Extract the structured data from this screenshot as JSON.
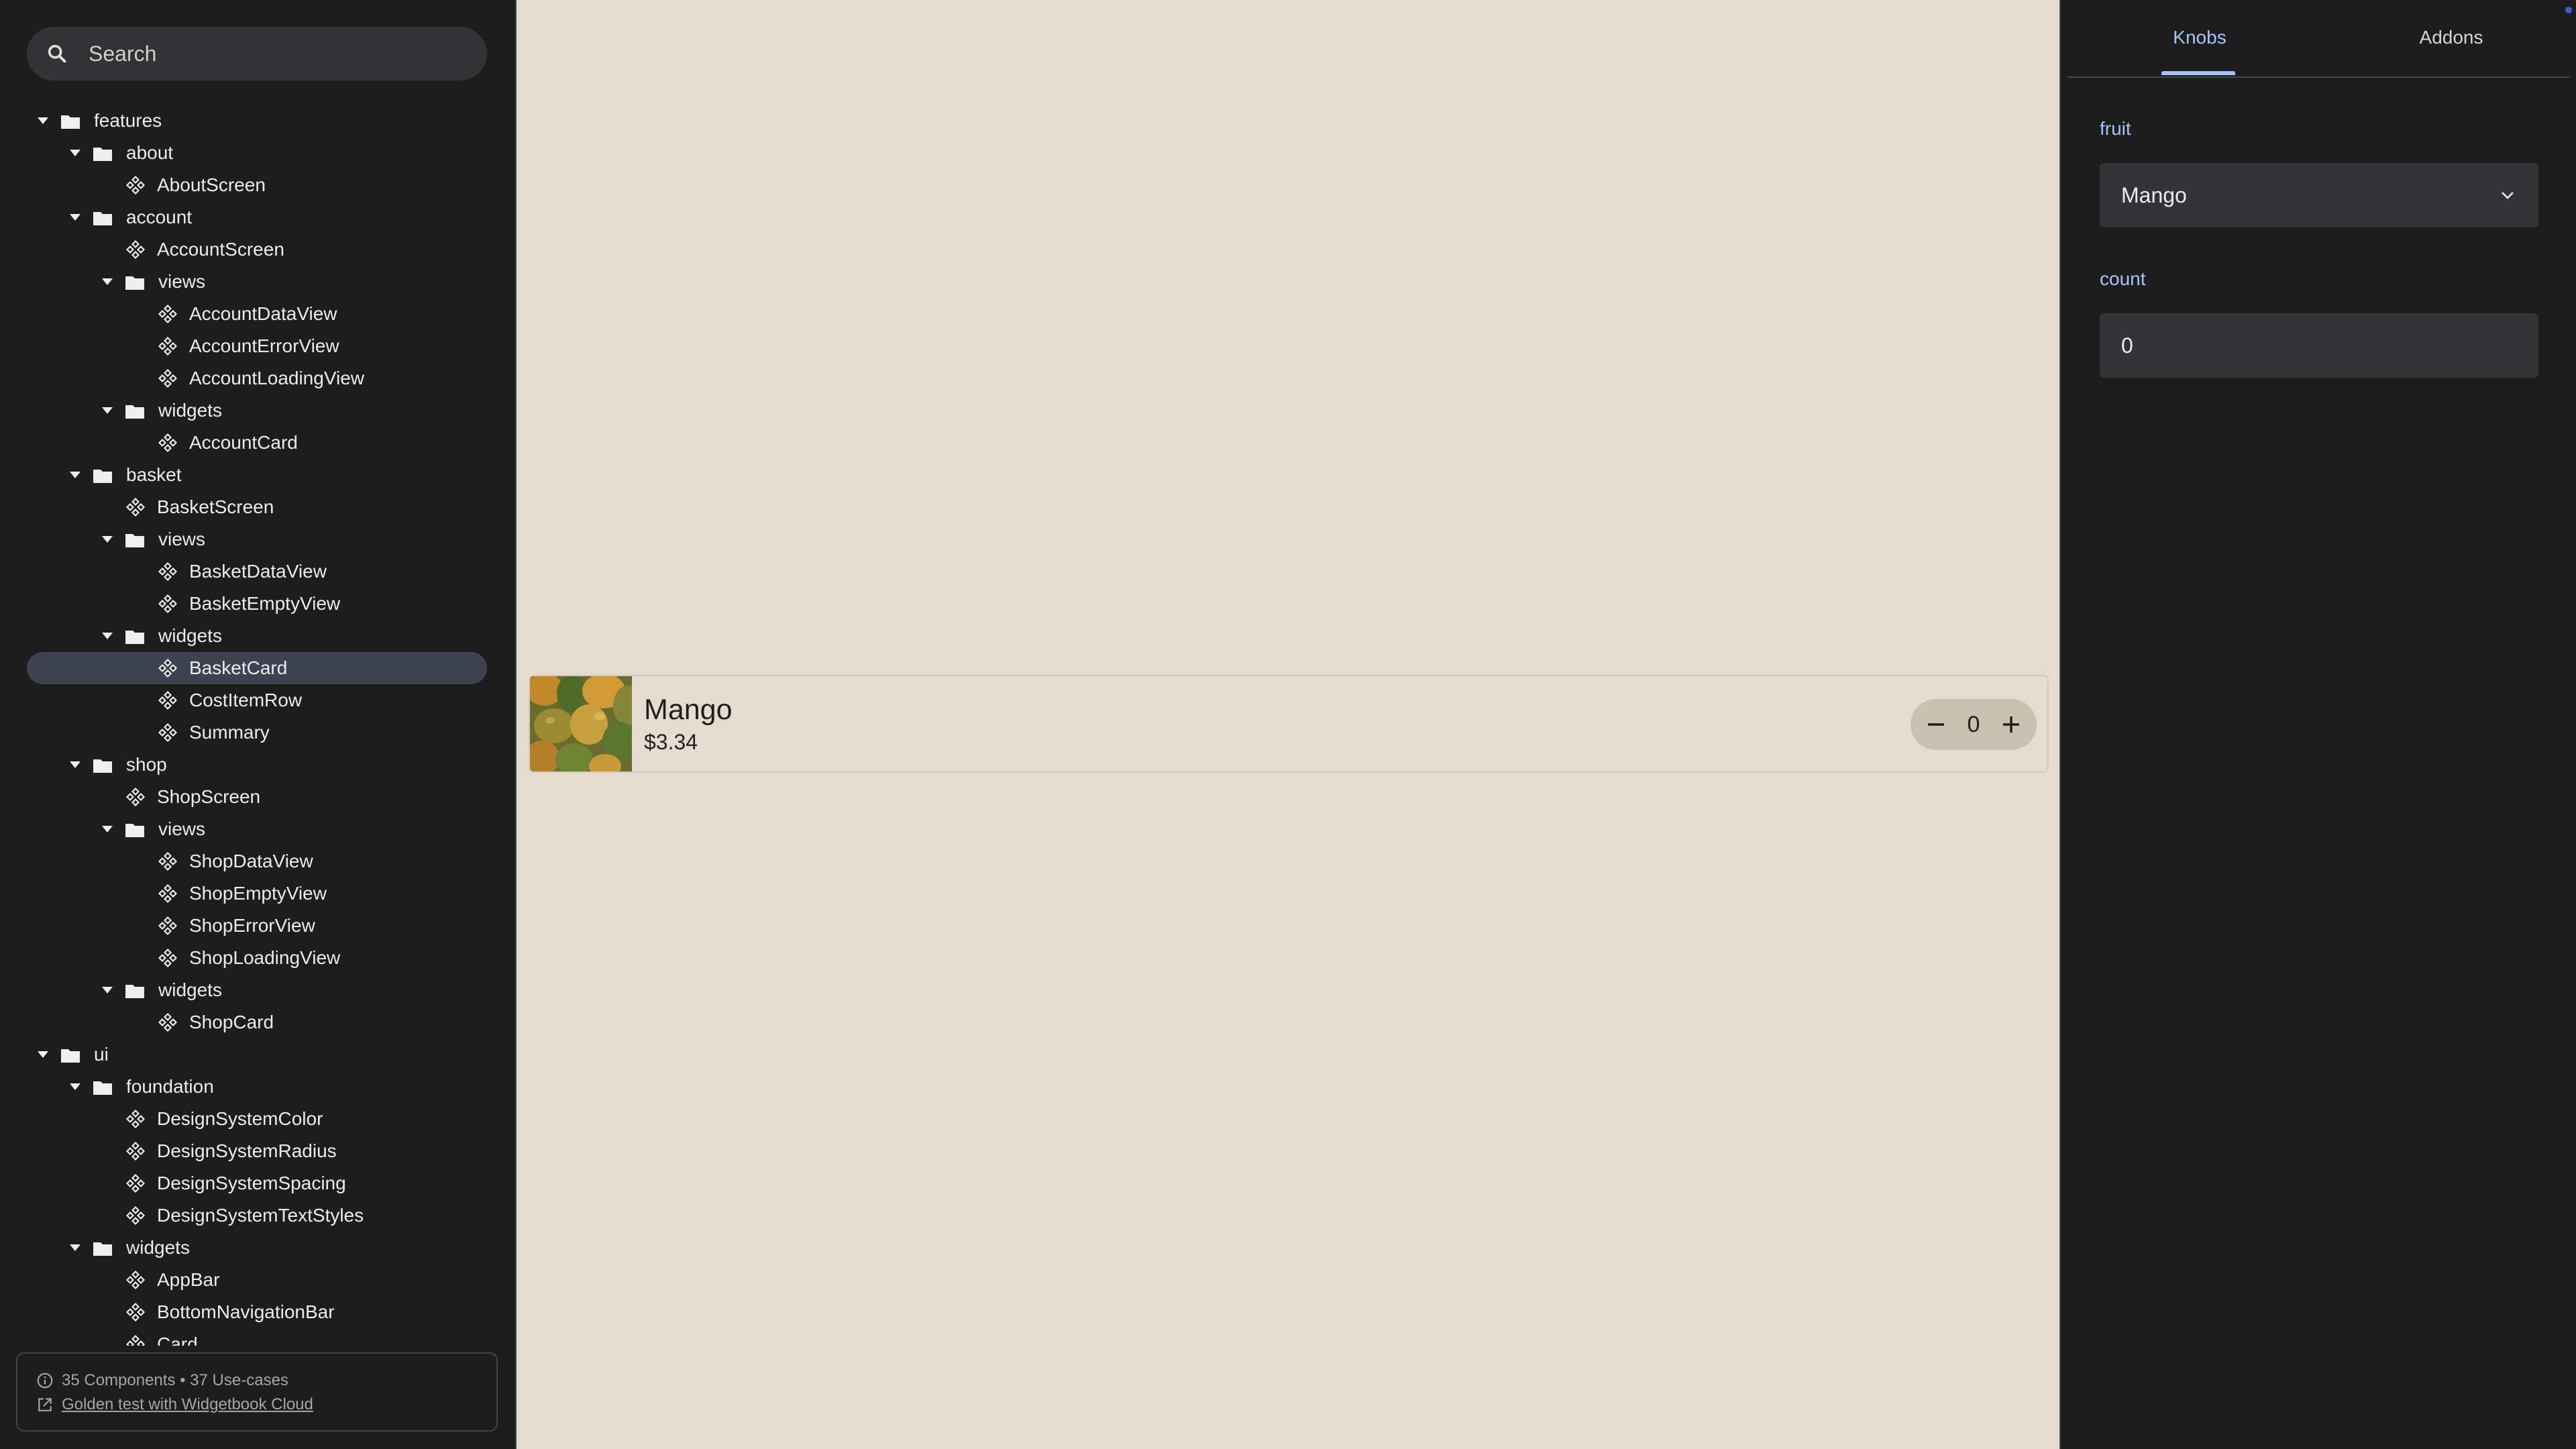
{
  "search": {
    "placeholder": "Search"
  },
  "tree": [
    {
      "kind": "folder",
      "label": "features",
      "depth": 0
    },
    {
      "kind": "folder",
      "label": "about",
      "depth": 1
    },
    {
      "kind": "component",
      "label": "AboutScreen",
      "depth": 2
    },
    {
      "kind": "folder",
      "label": "account",
      "depth": 1
    },
    {
      "kind": "component",
      "label": "AccountScreen",
      "depth": 2
    },
    {
      "kind": "folder",
      "label": "views",
      "depth": 2
    },
    {
      "kind": "component",
      "label": "AccountDataView",
      "depth": 3
    },
    {
      "kind": "component",
      "label": "AccountErrorView",
      "depth": 3
    },
    {
      "kind": "component",
      "label": "AccountLoadingView",
      "depth": 3
    },
    {
      "kind": "folder",
      "label": "widgets",
      "depth": 2
    },
    {
      "kind": "component",
      "label": "AccountCard",
      "depth": 3
    },
    {
      "kind": "folder",
      "label": "basket",
      "depth": 1
    },
    {
      "kind": "component",
      "label": "BasketScreen",
      "depth": 2
    },
    {
      "kind": "folder",
      "label": "views",
      "depth": 2
    },
    {
      "kind": "component",
      "label": "BasketDataView",
      "depth": 3
    },
    {
      "kind": "component",
      "label": "BasketEmptyView",
      "depth": 3
    },
    {
      "kind": "folder",
      "label": "widgets",
      "depth": 2
    },
    {
      "kind": "component",
      "label": "BasketCard",
      "depth": 3,
      "selected": true
    },
    {
      "kind": "component",
      "label": "CostItemRow",
      "depth": 3
    },
    {
      "kind": "component",
      "label": "Summary",
      "depth": 3
    },
    {
      "kind": "folder",
      "label": "shop",
      "depth": 1
    },
    {
      "kind": "component",
      "label": "ShopScreen",
      "depth": 2
    },
    {
      "kind": "folder",
      "label": "views",
      "depth": 2
    },
    {
      "kind": "component",
      "label": "ShopDataView",
      "depth": 3
    },
    {
      "kind": "component",
      "label": "ShopEmptyView",
      "depth": 3
    },
    {
      "kind": "component",
      "label": "ShopErrorView",
      "depth": 3
    },
    {
      "kind": "component",
      "label": "ShopLoadingView",
      "depth": 3
    },
    {
      "kind": "folder",
      "label": "widgets",
      "depth": 2
    },
    {
      "kind": "component",
      "label": "ShopCard",
      "depth": 3
    },
    {
      "kind": "folder",
      "label": "ui",
      "depth": 0
    },
    {
      "kind": "folder",
      "label": "foundation",
      "depth": 1
    },
    {
      "kind": "component",
      "label": "DesignSystemColor",
      "depth": 2
    },
    {
      "kind": "component",
      "label": "DesignSystemRadius",
      "depth": 2
    },
    {
      "kind": "component",
      "label": "DesignSystemSpacing",
      "depth": 2
    },
    {
      "kind": "component",
      "label": "DesignSystemTextStyles",
      "depth": 2
    },
    {
      "kind": "folder",
      "label": "widgets",
      "depth": 1
    },
    {
      "kind": "component",
      "label": "AppBar",
      "depth": 2
    },
    {
      "kind": "component",
      "label": "BottomNavigationBar",
      "depth": 2
    },
    {
      "kind": "component",
      "label": "Card",
      "depth": 2
    }
  ],
  "footer": {
    "stats": "35 Components • 37 Use-cases",
    "link": "Golden test with Widgetbook Cloud"
  },
  "preview": {
    "card": {
      "title": "Mango",
      "price": "$3.34",
      "count": "0"
    }
  },
  "panel": {
    "tabs": [
      "Knobs",
      "Addons"
    ],
    "active_tab": "Knobs",
    "knobs": [
      {
        "label": "fruit",
        "value": "Mango",
        "type": "dropdown"
      },
      {
        "label": "count",
        "value": "0",
        "type": "number"
      }
    ]
  },
  "colors": {
    "accent": "#a8c4ff",
    "preview_bg": "#e4dccf",
    "sidebar_bg": "#1d1d1d",
    "selected_row": "#3d4350"
  }
}
